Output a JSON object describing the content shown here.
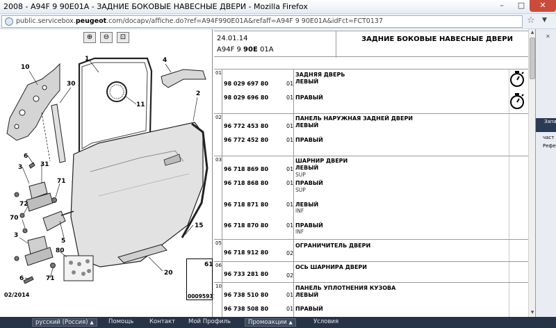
{
  "window": {
    "title": "2008 - A94F 9 90E01A - ЗАДНИЕ БОКОВЫЕ НАВЕСНЫЕ ДВЕРИ - Mozilla Firefox",
    "controls": [
      "minimize",
      "maximize",
      "close"
    ]
  },
  "urlbar": {
    "prefix": "public.servicebox.",
    "domain": "peugeot",
    "suffix": ".com/docapv/affiche.do?ref=A94F990E01A&refaff=A94F 9 90E01A&idFct=FCT0137"
  },
  "diagram": {
    "zoom_buttons": [
      "zoom-in",
      "zoom-out",
      "zoom-fit"
    ],
    "date_label": "02/2014",
    "code_box_num": "61",
    "code_box_text": "00095931",
    "callouts": [
      "10",
      "1",
      "4",
      "2",
      "30",
      "11",
      "6",
      "31",
      "3",
      "71",
      "72",
      "70",
      "5",
      "15",
      "3",
      "80",
      "6",
      "71",
      "20"
    ]
  },
  "table": {
    "header": {
      "date": "24.01.14",
      "code_pre": "A94F 9 ",
      "code_bold": "90E",
      "code_post": " 01A",
      "title": "ЗАДНИЕ БОКОВЫЕ НАВЕСНЫЕ ДВЕРИ"
    },
    "groups": [
      {
        "num": "01",
        "rows": [
          {
            "pn": "",
            "qty": "",
            "name": "ЗАДНЯЯ ДВЕРЬ",
            "sub": ""
          },
          {
            "pn": "98 029 697 80",
            "qty": "01",
            "name": "ЛЕВЫЙ",
            "sub": ""
          },
          {
            "pn": "98 029 696 80",
            "qty": "01",
            "name": "ПРАВЫЙ",
            "sub": ""
          }
        ]
      },
      {
        "num": "02",
        "rows": [
          {
            "pn": "",
            "qty": "",
            "name": "ПАНЕЛЬ НАРУЖНАЯ ЗАДНЕЙ ДВЕРИ",
            "sub": ""
          },
          {
            "pn": "96 772 453 80",
            "qty": "01",
            "name": "ЛЕВЫЙ",
            "sub": ""
          },
          {
            "pn": "96 772 452 80",
            "qty": "01",
            "name": "ПРАВЫЙ",
            "sub": ""
          }
        ]
      },
      {
        "num": "03",
        "rows": [
          {
            "pn": "",
            "qty": "",
            "name": "ШАРНИР ДВЕРИ",
            "sub": ""
          },
          {
            "pn": "96 718 869 80",
            "qty": "01",
            "name": "ЛЕВЫЙ",
            "sub": "SUP"
          },
          {
            "pn": "96 718 868 80",
            "qty": "01",
            "name": "ПРАВЫЙ",
            "sub": "SUP"
          },
          {
            "pn": "96 718 871 80",
            "qty": "01",
            "name": "ЛЕВЫЙ",
            "sub": "INF"
          },
          {
            "pn": "96 718 870 80",
            "qty": "01",
            "name": "ПРАВЫЙ",
            "sub": "INF"
          }
        ]
      },
      {
        "num": "05",
        "rows": [
          {
            "pn": "96 718 912 80",
            "qty": "02",
            "name": "ОГРАНИЧИТЕЛЬ ДВЕРИ",
            "sub": ""
          }
        ]
      },
      {
        "num": "06",
        "rows": [
          {
            "pn": "96 733 281 80",
            "qty": "02",
            "name": "ОСЬ ШАРНИРА ДВЕРИ",
            "sub": ""
          }
        ]
      },
      {
        "num": "10",
        "rows": [
          {
            "pn": "",
            "qty": "",
            "name": "ПАНЕЛЬ УПЛОТНЕНИЯ КУЗОВА",
            "sub": ""
          },
          {
            "pn": "96 738 510 80",
            "qty": "01",
            "name": "ЛЕВЫЙ",
            "sub": ""
          },
          {
            "pn": "96 738 508 80",
            "qty": "01",
            "name": "ПРАВЫЙ",
            "sub": ""
          }
        ]
      }
    ]
  },
  "background_window": {
    "line1": "Запа",
    "line2": "част",
    "line3": "Рефе"
  },
  "taskbar": {
    "language": "русский (Россия)",
    "help": "Помощь",
    "contact": "Контакт",
    "profile": "Мой Профиль",
    "promo": "Промоакции",
    "terms": "Условия"
  }
}
